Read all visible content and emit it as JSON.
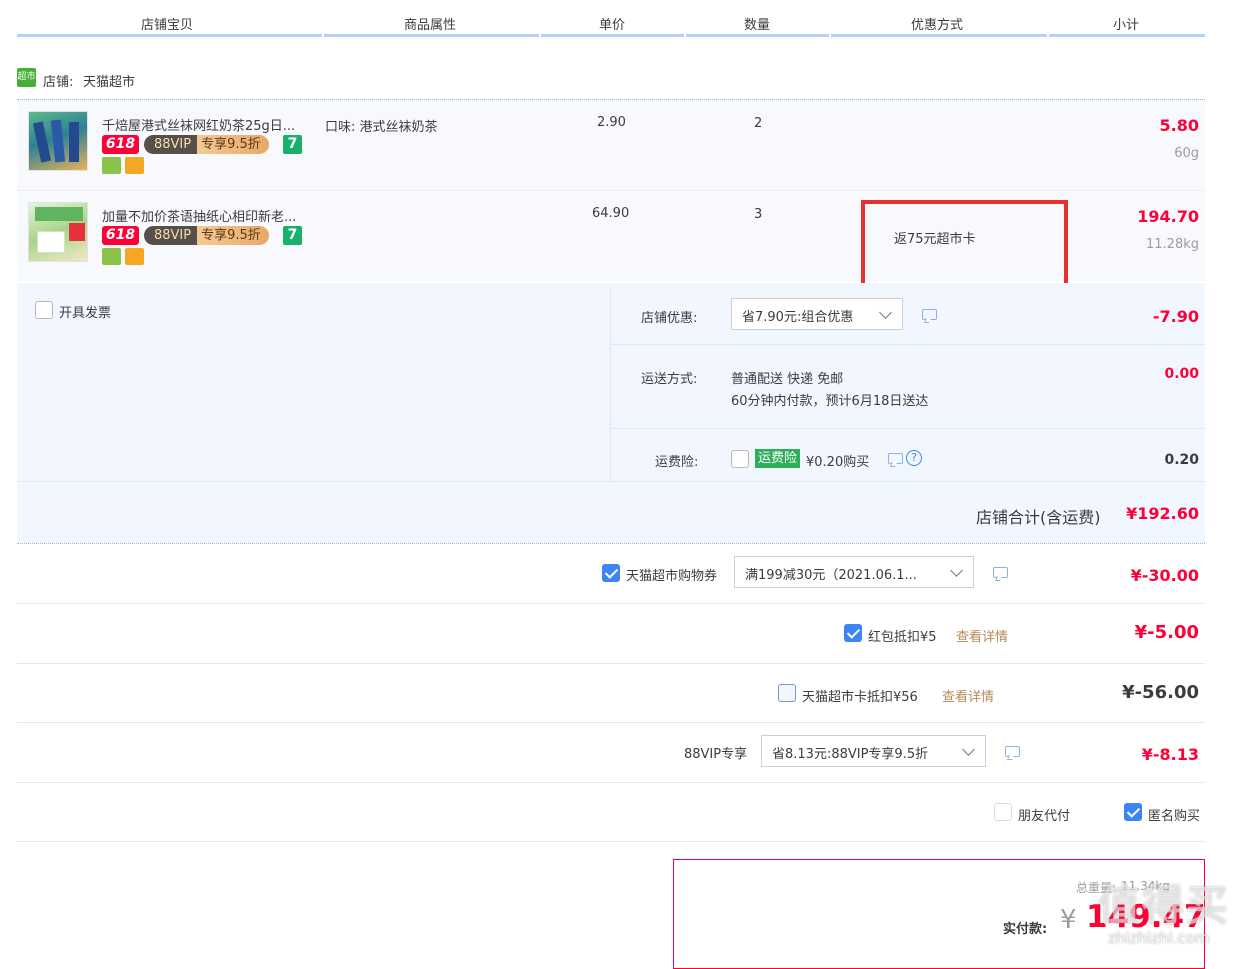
{
  "headers": [
    "店铺宝贝",
    "商品属性",
    "单价",
    "数量",
    "优惠方式",
    "小计"
  ],
  "shop": {
    "label": "店铺:",
    "name": "天猫超市",
    "logo_text": "超市"
  },
  "items": [
    {
      "name": "千焙屋港式丝袜网红奶茶25g日...",
      "attr": "口味: 港式丝袜奶茶",
      "price": "2.90",
      "qty": "2",
      "promo": "",
      "subtotal": "5.80",
      "weight": "60g",
      "badge_618": "618",
      "badge_vip_left": "88VIP",
      "badge_vip_right": "专享9.5折",
      "badge_7": "7"
    },
    {
      "name": "加量不加价茶语抽纸心相印新老...",
      "attr": "",
      "price": "64.90",
      "qty": "3",
      "promo": "返75元超市卡",
      "subtotal": "194.70",
      "weight": "11.28kg",
      "badge_618": "618",
      "badge_vip_left": "88VIP",
      "badge_vip_right": "专享9.5折",
      "badge_7": "7"
    }
  ],
  "invoice": {
    "label": "开具发票",
    "checked": false
  },
  "shop_discount": {
    "label": "店铺优惠:",
    "select": "省7.90元:组合优惠",
    "amount": "-7.90"
  },
  "shipping": {
    "label": "运送方式:",
    "line1": "普通配送 快递 免邮",
    "line2": "60分钟内付款，预计6月18日送达",
    "amount": "0.00"
  },
  "insurance": {
    "label": "运费险:",
    "tag": "运费险",
    "text": "¥0.20购买",
    "amount": "0.20",
    "help": "?"
  },
  "shop_total": {
    "label": "店铺合计(含运费)",
    "amount": "¥192.60"
  },
  "coupon": {
    "label": "天猫超市购物券",
    "select": "满199减30元（2021.06.1...",
    "amount": "¥-30.00",
    "checked": true
  },
  "redpacket": {
    "label": "红包抵扣¥5",
    "link": "查看详情",
    "amount": "¥-5.00",
    "checked": true
  },
  "card": {
    "label": "天猫超市卡抵扣¥56",
    "link": "查看详情",
    "amount": "¥-56.00",
    "checked": false
  },
  "vip": {
    "label": "88VIP专享",
    "select": "省8.13元:88VIP专享9.5折",
    "amount": "¥-8.13"
  },
  "friend_pay": {
    "label": "朋友代付",
    "checked": false
  },
  "anonymous": {
    "label": "匿名购买",
    "checked": true
  },
  "total": {
    "weight_label": "总重量:",
    "weight": "11.34kg",
    "pay_label": "实付款:",
    "currency": "¥",
    "amount": "149.47"
  },
  "watermark": {
    "text": "值得买",
    "url": "zhizhizhi.com"
  },
  "colors": {
    "accent_red": "#ff0036",
    "header_line": "#b2d1ff",
    "row_bg": "#f7f9fc",
    "panel_bg": "#f2f7ff",
    "highlight_box": "#e8302f"
  }
}
